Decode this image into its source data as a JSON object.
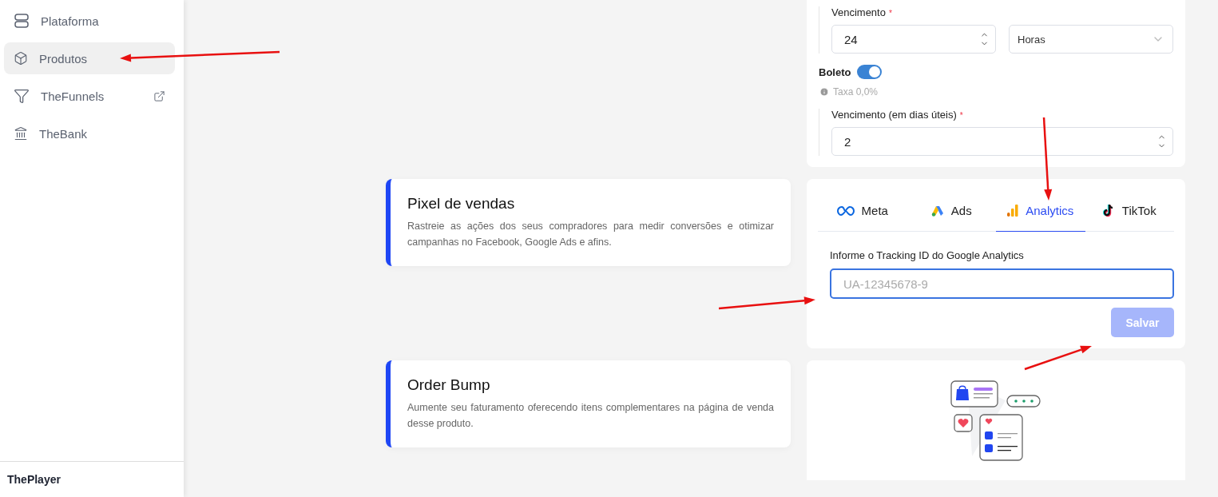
{
  "sidebar": {
    "items": [
      {
        "label": "Plataforma",
        "kind": "rows",
        "selected": false,
        "external": false
      },
      {
        "label": "Produtos",
        "kind": "box",
        "selected": true,
        "external": false
      },
      {
        "label": "TheFunnels",
        "kind": "funnel",
        "selected": false,
        "external": true
      },
      {
        "label": "TheBank",
        "kind": "bank",
        "selected": false,
        "external": false
      }
    ],
    "footer": "ThePlayer"
  },
  "payment_card": {
    "pix_expiry": {
      "label": "Vencimento",
      "required_mark": "*",
      "value": "24",
      "unit": "Horas"
    },
    "boleto": {
      "label": "Boleto",
      "on": true,
      "fee": "Taxa 0,0%"
    },
    "boleto_expiry": {
      "label": "Vencimento (em dias úteis)",
      "required_mark": "*",
      "value": "2"
    }
  },
  "sections": [
    {
      "title": "Pixel de vendas",
      "description": "Rastreie as ações dos seus compradores para medir conversões e otimizar campanhas no Facebook, Google Ads e afins."
    },
    {
      "title": "Order Bump",
      "description": "Aumente seu faturamento oferecendo itens complementares na página de venda desse produto."
    }
  ],
  "pixel_card": {
    "tabs": [
      {
        "label": "Meta",
        "kind": "meta",
        "selected": false
      },
      {
        "label": "Ads",
        "kind": "ads",
        "selected": false
      },
      {
        "label": "Analytics",
        "kind": "analytics",
        "selected": true
      },
      {
        "label": "TikTok",
        "kind": "tiktok",
        "selected": false
      }
    ],
    "field_label": "Informe o Tracking ID do Google Analytics",
    "placeholder": "UA-12345678-9",
    "save_button": {
      "label": "Salvar",
      "disabled": true
    }
  }
}
